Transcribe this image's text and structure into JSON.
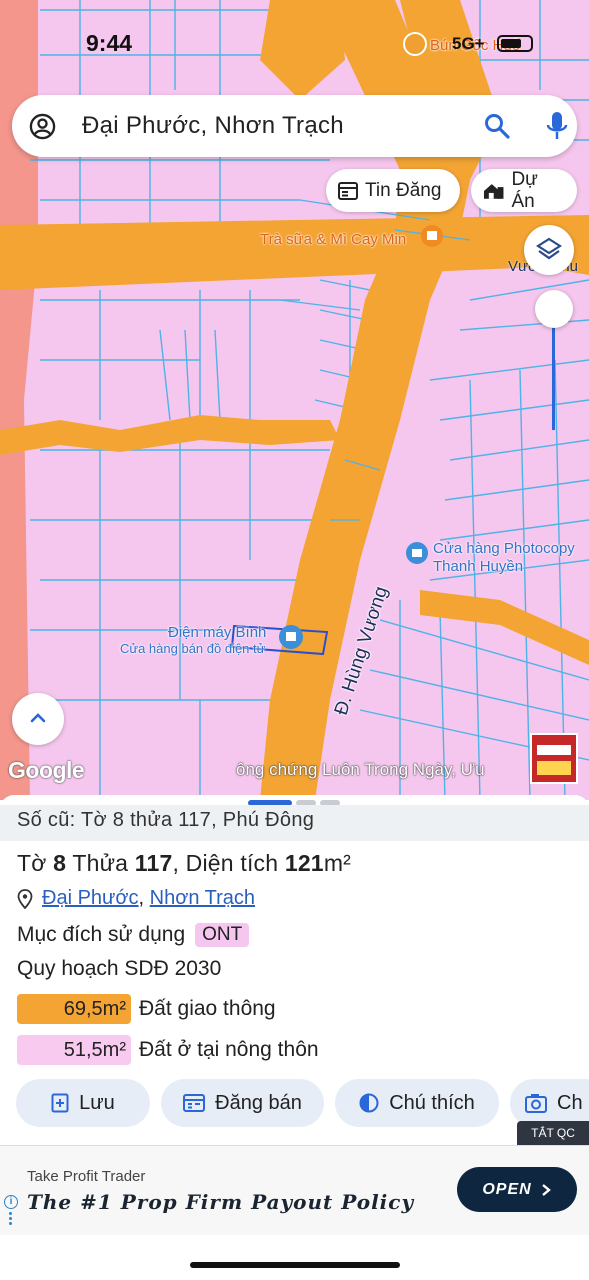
{
  "status_bar": {
    "time": "9:44",
    "network": "5G+"
  },
  "search": {
    "query": "Đại Phước, Nhơn Trạch"
  },
  "chips": {
    "tin_dang": "Tin Đăng",
    "du_an": "Dự Án"
  },
  "map": {
    "poi": {
      "top_right": "Bún Gốc Huế",
      "tra_sua": "Trà sữa & Mì Cay Min",
      "street_vuon": "Vườn Chu",
      "photocopy_line1": "Cửa hàng Photocopy",
      "photocopy_line2": "Thanh Huyền",
      "dien_may_line1": "Điện máy Bình",
      "dien_may_line2": "Cửa hàng bán đồ điện tử",
      "street_main": "Đ. Hùng Vương"
    },
    "google_logo": "Google",
    "ticker": "ông chứng Luôn Trong Ngày, Ưu"
  },
  "sheet": {
    "old_info": "Số cũ: Tờ 8 thửa 117, Phú Đông",
    "to_label": "Tờ",
    "to_value": "8",
    "thua_label": "Thửa",
    "thua_value": "117",
    "area_label": ", Diện tích",
    "area_value": "121",
    "area_unit": "m²",
    "ward": "Đại Phước",
    "district": "Nhơn Trạch",
    "purpose_label": "Mục đích sử dụng",
    "purpose_code": "ONT",
    "plan_label": "Quy hoạch SDĐ 2030",
    "zones": [
      {
        "area": "69,5m²",
        "label": "Đất giao thông",
        "color": "#f3a433"
      },
      {
        "area": "51,5m²",
        "label": "Đất ở tại nông thôn",
        "color": "#f8caf0"
      }
    ],
    "actions": {
      "luu": "Lưu",
      "dang_ban": "Đăng bán",
      "chu_thich": "Chú thích",
      "chup": "Ch"
    },
    "tat_qc": "TẮT QC"
  },
  "ad": {
    "advertiser": "Take Profit Trader",
    "headline": "The #1 Prop Firm Payout Policy",
    "cta": "OPEN"
  },
  "colors": {
    "road": "#f3a433",
    "residential": "#f6c7ee",
    "parcel_line": "#4fb3e6",
    "accent": "#2a67d8"
  }
}
